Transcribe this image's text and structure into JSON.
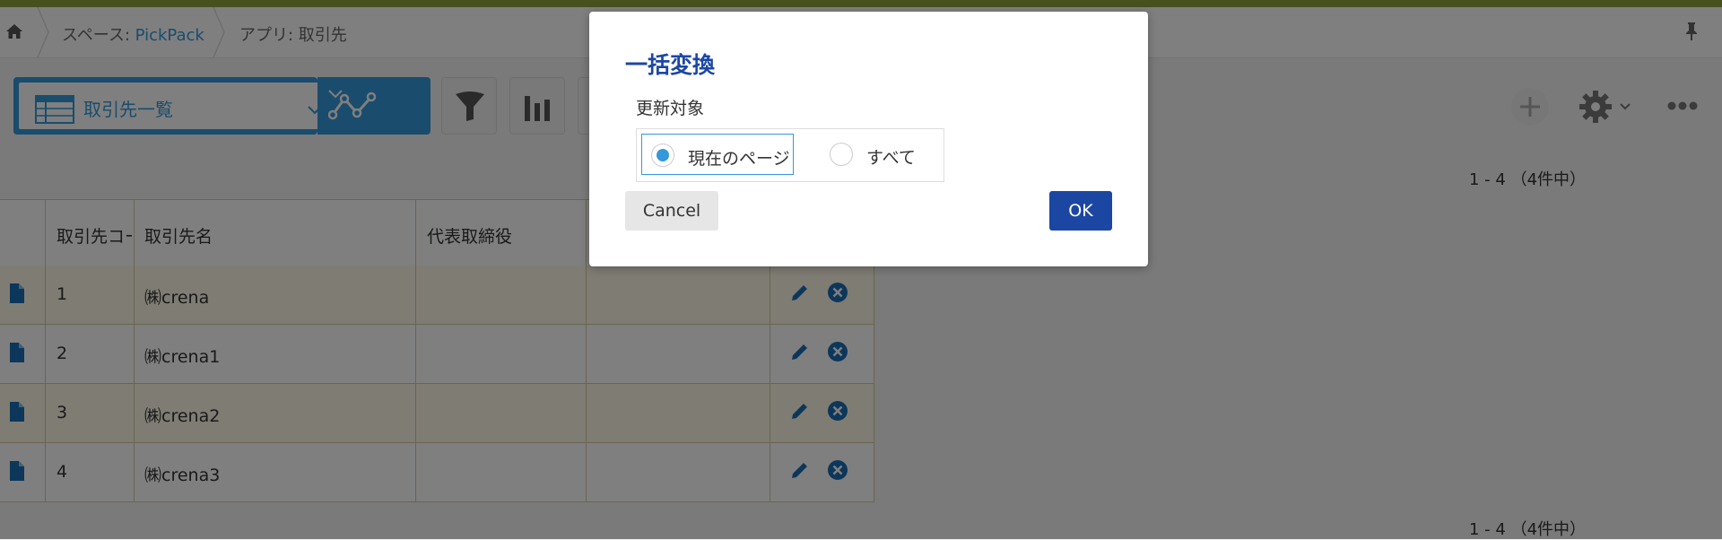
{
  "header": {
    "space_prefix": "スペース: ",
    "space_name": "PickPack",
    "app_crumb": "アプリ: 取引先"
  },
  "toolbar": {
    "view_label": "取引先一覧",
    "icons": [
      "table-view-icon",
      "graph-icon",
      "filter-icon",
      "chart-icon",
      "add-icon",
      "gear-icon",
      "more-icon"
    ]
  },
  "pagination": {
    "top": "1 - 4 （4件中）",
    "bottom": "1 - 4 （4件中）"
  },
  "table": {
    "columns": [
      "取引先コード",
      "取引先名",
      "代表取締役"
    ],
    "rows": [
      {
        "code": "1",
        "name": "㈱crena"
      },
      {
        "code": "2",
        "name": "㈱crena1"
      },
      {
        "code": "3",
        "name": "㈱crena2"
      },
      {
        "code": "4",
        "name": "㈱crena3"
      }
    ]
  },
  "dialog": {
    "title": "一括変換",
    "section_label": "更新対象",
    "options": [
      "現在のページ",
      "すべて"
    ],
    "selected_option": "現在のページ",
    "cancel_label": "Cancel",
    "ok_label": "OK"
  },
  "colors": {
    "accent": "#3498db",
    "dialog_primary": "#1b47a3",
    "top_bar": "#8fa33a"
  }
}
